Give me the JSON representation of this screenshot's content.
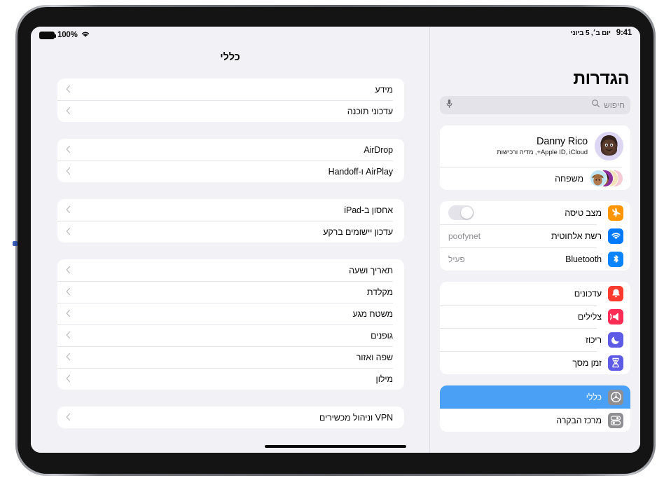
{
  "status_bar": {
    "battery_percent": "100%",
    "battery_icon": "battery-full-icon",
    "wifi_icon": "wifi-icon",
    "time": "9:41",
    "date": "יום ב׳, 5 ביוני"
  },
  "sidebar": {
    "title": "הגדרות",
    "search": {
      "placeholder": "חיפוש",
      "search_icon": "search-icon",
      "mic_icon": "microphone-icon"
    },
    "profile": {
      "name": "Danny Rico",
      "subtitle": "Apple ID, iCloud+, מדיה ורכישות",
      "avatar_icon": "memoji-avatar",
      "family_label": "משפחה",
      "family_avatars": [
        "memoji-avatar-1",
        "memoji-avatar-2",
        "memoji-avatar-3",
        "memoji-avatar-4"
      ]
    },
    "connectivity": [
      {
        "label": "מצב טיסה",
        "icon": "airplane-icon",
        "icon_color": "#FF9500",
        "control": "toggle",
        "toggle_on": false
      },
      {
        "label": "רשת אלחוטית",
        "icon": "wifi-icon",
        "icon_color": "#007AFF",
        "value": "poofynet"
      },
      {
        "label": "Bluetooth",
        "icon": "bluetooth-icon",
        "icon_color": "#0A84FF",
        "value": "פעיל"
      }
    ],
    "alerts": [
      {
        "label": "עדכונים",
        "icon": "bell-icon",
        "icon_color": "#FF3B30"
      },
      {
        "label": "צלילים",
        "icon": "speaker-waves-icon",
        "icon_color": "#FF2D55"
      },
      {
        "label": "ריכוז",
        "icon": "moon-icon",
        "icon_color": "#5E5CE6"
      },
      {
        "label": "זמן מסך",
        "icon": "hourglass-icon",
        "icon_color": "#5E5CE6"
      }
    ],
    "system": [
      {
        "label": "כללי",
        "icon": "gear-icon",
        "icon_color": "#8E8E93",
        "selected": true
      },
      {
        "label": "מרכז הבקרה",
        "icon": "control-center-icon",
        "icon_color": "#8E8E93",
        "selected": false
      }
    ],
    "selected_accent": "#4AA0F5"
  },
  "content": {
    "title": "כללי",
    "chevron_icon": "chevron-back-icon",
    "groups": [
      {
        "rows": [
          {
            "label": "מידע"
          },
          {
            "label": "עדכוני תוכנה"
          }
        ]
      },
      {
        "rows": [
          {
            "label": "AirDrop"
          },
          {
            "label": "AirPlay ו-Handoff"
          }
        ]
      },
      {
        "rows": [
          {
            "label": "אחסון ב-iPad"
          },
          {
            "label": "עדכון יישומים ברקע"
          }
        ]
      },
      {
        "rows": [
          {
            "label": "תאריך ושעה"
          },
          {
            "label": "מקלדת"
          },
          {
            "label": "משטח מגע"
          },
          {
            "label": "גופנים"
          },
          {
            "label": "שפה ואזור"
          },
          {
            "label": "מילון"
          }
        ]
      },
      {
        "rows": [
          {
            "label": "VPN וניהול מכשירים"
          }
        ]
      }
    ]
  }
}
